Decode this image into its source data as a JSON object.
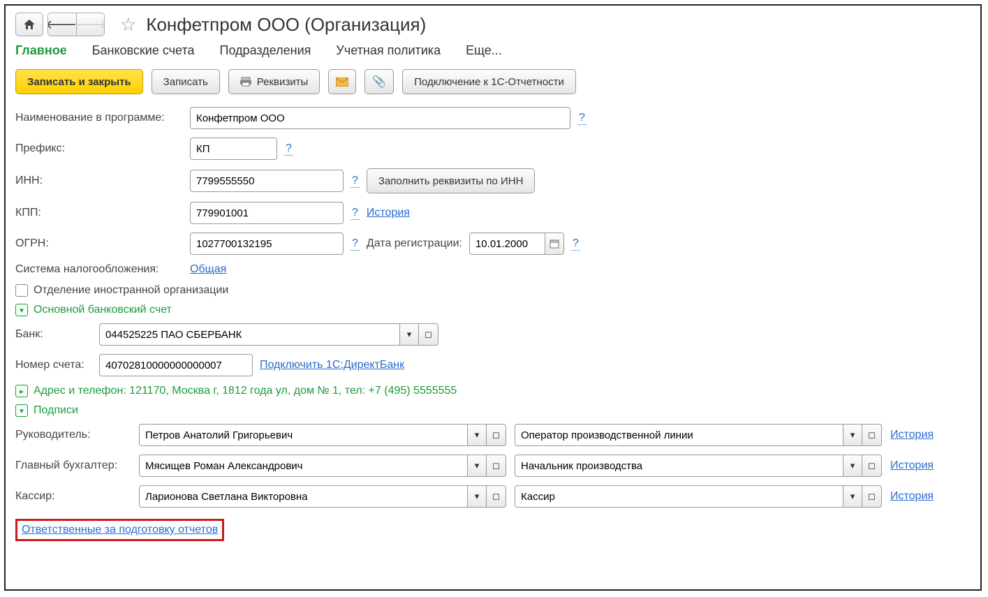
{
  "header": {
    "title": "Конфетпром ООО (Организация)"
  },
  "tabs": {
    "main": "Главное",
    "bank": "Банковские счета",
    "divisions": "Подразделения",
    "accounting": "Учетная политика",
    "more": "Еще..."
  },
  "toolbar": {
    "save_close": "Записать и закрыть",
    "save": "Записать",
    "requisites": "Реквизиты",
    "connect_1c": "Подключение к 1С-Отчетности"
  },
  "fields": {
    "program_name_label": "Наименование в программе:",
    "program_name_value": "Конфетпром ООО",
    "prefix_label": "Префикс:",
    "prefix_value": "КП",
    "inn_label": "ИНН:",
    "inn_value": "7799555550",
    "fill_by_inn": "Заполнить реквизиты по ИНН",
    "kpp_label": "КПП:",
    "kpp_value": "779901001",
    "history": "История",
    "ogrn_label": "ОГРН:",
    "ogrn_value": "1027700132195",
    "reg_date_label": "Дата регистрации:",
    "reg_date_value": "10.01.2000",
    "tax_label": "Система налогообложения:",
    "tax_value": "Общая",
    "foreign_label": "Отделение иностранной организации"
  },
  "bank_section": {
    "title": "Основной банковский счет",
    "bank_label": "Банк:",
    "bank_value": "044525225 ПАО СБЕРБАНК",
    "account_label": "Номер счета:",
    "account_value": "40702810000000000007",
    "direct_bank": "Подключить 1С:ДиректБанк"
  },
  "address_section": {
    "title": "Адрес и телефон: 121170, Москва г, 1812 года ул, дом № 1, тел: +7 (495) 5555555"
  },
  "sign_section": {
    "title": "Подписи",
    "director_label": "Руководитель:",
    "director_person": "Петров Анатолий Григорьевич",
    "director_position": "Оператор производственной линии",
    "accountant_label": "Главный бухгалтер:",
    "accountant_person": "Мясищев Роман Александрович",
    "accountant_position": "Начальник производства",
    "cashier_label": "Кассир:",
    "cashier_person": "Ларионова Светлана Викторовна",
    "cashier_position": "Кассир",
    "history": "История"
  },
  "footer": {
    "responsible_link": "Ответственные за подготовку отчетов"
  },
  "help": "?"
}
